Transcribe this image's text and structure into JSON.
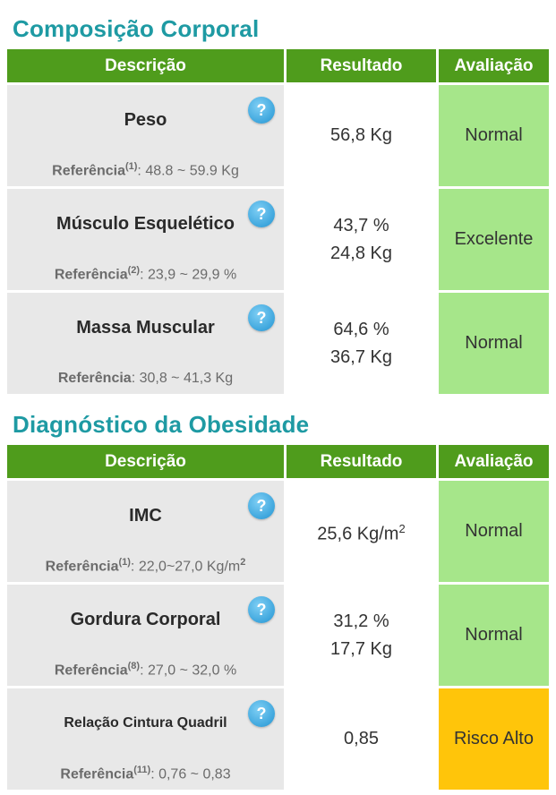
{
  "sections": [
    {
      "title": "Composição Corporal",
      "headers": {
        "descricao": "Descrição",
        "resultado": "Resultado",
        "avaliacao": "Avaliação"
      },
      "rows": [
        {
          "name": "Peso",
          "ref_label": "Referência",
          "ref_sup": "(1)",
          "ref_value": ": 48.8 ~ 59.9 Kg",
          "result_1": "56,8 Kg",
          "result_2": "",
          "evaluation": "Normal"
        },
        {
          "name": "Músculo Esquelético",
          "ref_label": "Referência",
          "ref_sup": "(2)",
          "ref_value": ": 23,9 ~ 29,9 %",
          "result_1": "43,7 %",
          "result_2": "24,8 Kg",
          "evaluation": "Excelente"
        },
        {
          "name": "Massa Muscular",
          "ref_label": "Referência",
          "ref_sup": "",
          "ref_value": ": 30,8 ~ 41,3 Kg",
          "result_1": "64,6 %",
          "result_2": "36,7 Kg",
          "evaluation": "Normal"
        }
      ]
    },
    {
      "title": "Diagnóstico da Obesidade",
      "headers": {
        "descricao": "Descrição",
        "resultado": "Resultado",
        "avaliacao": "Avaliação"
      },
      "rows": [
        {
          "name": "IMC",
          "ref_label": "Referência",
          "ref_sup": "(1)",
          "ref_value": ": 22,0~27,0 Kg/m",
          "ref_value_sup": "2",
          "result_1": "25,6 Kg/m",
          "result_1_sup": "2",
          "result_2": "",
          "evaluation": "Normal"
        },
        {
          "name": "Gordura Corporal",
          "ref_label": "Referência",
          "ref_sup": "(8)",
          "ref_value": ": 27,0 ~ 32,0 %",
          "result_1": "31,2 %",
          "result_2": "17,7 Kg",
          "evaluation": "Normal"
        },
        {
          "name": "Relação Cintura Quadril",
          "ref_label": "Referência",
          "ref_sup": "(11)",
          "ref_value": ": 0,76 ~ 0,83",
          "result_1": "0,85",
          "result_2": "",
          "evaluation": "Risco Alto"
        }
      ]
    }
  ],
  "help_icon_glyph": "?",
  "colors": {
    "title": "#1e9aa3",
    "header_bg": "#4f9c1c",
    "eval_green": "#a6e68a",
    "eval_alert": "#ffc50a",
    "desc_bg": "#e8e8e8"
  },
  "icons": {
    "help": "question-circle-icon"
  }
}
